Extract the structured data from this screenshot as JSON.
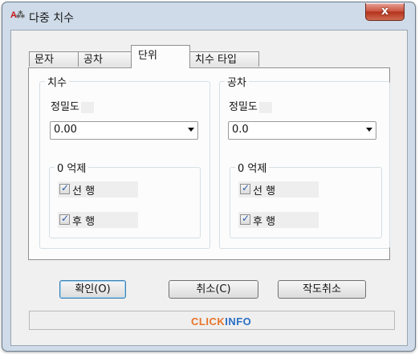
{
  "window": {
    "title": "다중 치수",
    "close_glyph": "x"
  },
  "tabs": [
    {
      "label": "문자",
      "active": false
    },
    {
      "label": "공차",
      "active": false
    },
    {
      "label": "단위",
      "active": true
    },
    {
      "label": "치수 타입",
      "active": false
    }
  ],
  "dimension_group": {
    "title": "치수",
    "precision_label": "정밀도",
    "precision_value": "0.00",
    "suppress_title": "0 억제",
    "leading_label": "선 행",
    "leading_checked": true,
    "trailing_label": "후 행",
    "trailing_checked": true
  },
  "tolerance_group": {
    "title": "공차",
    "precision_label": "정밀도",
    "precision_value": "0.0",
    "suppress_title": "0 억제",
    "leading_label": "선 행",
    "leading_checked": true,
    "trailing_label": "후 행",
    "trailing_checked": true
  },
  "buttons": {
    "ok": "확인(O)",
    "cancel": "취소(C)",
    "cancel_drawing": "작도취소"
  },
  "watermark": {
    "part1": "CLICK",
    "part2": "INFO",
    "color1": "#e8742a",
    "color2": "#2a6fc4"
  },
  "colors": {
    "window_frame": "#cfdbe8",
    "close_button": "#c9523d",
    "checkmark": "#2b5aa8"
  },
  "icons": {
    "app": "autocad-icon",
    "check": "✓"
  }
}
